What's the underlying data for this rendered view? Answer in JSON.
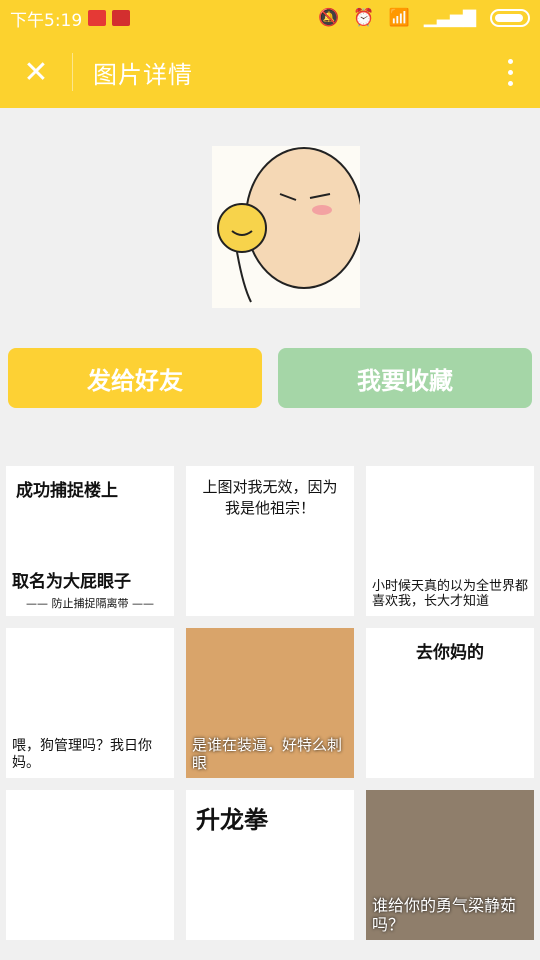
{
  "status_bar": {
    "time": "下午5:19",
    "battery_icon": "battery-icon",
    "signal_icon": "signal-icon",
    "wifi_icon": "wifi-icon"
  },
  "toolbar": {
    "title": "图片详情"
  },
  "actions": {
    "send_label": "发给好友",
    "collect_label": "我要收藏"
  },
  "grid": [
    {
      "top": "成功捕捉楼上",
      "bottom": "取名为大屁眼子",
      "sub": "—— 防止捕捉隔离带 ——"
    },
    {
      "top": "上图对我无效，因为我是他祖宗！",
      "bottom": ""
    },
    {
      "top": "",
      "bottom": "小时候天真的以为全世界都喜欢我，长大才知道"
    },
    {
      "top": "",
      "bottom": "喂，狗管理吗？我日你妈。"
    },
    {
      "top": "",
      "bottom": "是谁在装逼，好特么刺眼"
    },
    {
      "top": "去你妈的",
      "bottom": ""
    },
    {
      "top": "",
      "bottom": ""
    },
    {
      "top": "升龙拳",
      "bottom": ""
    },
    {
      "top": "",
      "bottom": "谁给你的勇气梁静茹吗？"
    }
  ],
  "colors": {
    "header": "#fcd22e",
    "send_button": "#fdd134",
    "collect_button": "#a5d6a7"
  }
}
